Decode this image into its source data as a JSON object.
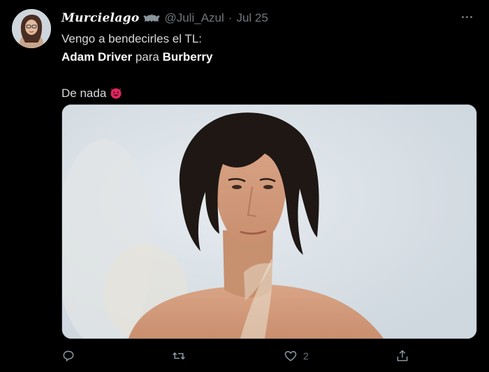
{
  "tweet": {
    "display_name": "Murcielago",
    "handle": "@Juli_Azul",
    "separator": "·",
    "date": "Jul 25",
    "text": {
      "line1": "Vengo a bendecirles el TL:",
      "bold1": "Adam Driver",
      "connector": " para ",
      "bold2": "Burberry",
      "line3": "De nada"
    },
    "emoji": "smiling-devil-emoji",
    "media": {
      "description_icon": "photo"
    },
    "actions": {
      "reply_icon": "reply-icon",
      "retweet_icon": "retweet-icon",
      "like_icon": "heart-icon",
      "like_count": "2",
      "share_icon": "share-icon"
    }
  },
  "colors": {
    "background": "#000000",
    "text": "#d9d9d9",
    "muted": "#6e767d",
    "emoji": "#e0245e"
  }
}
